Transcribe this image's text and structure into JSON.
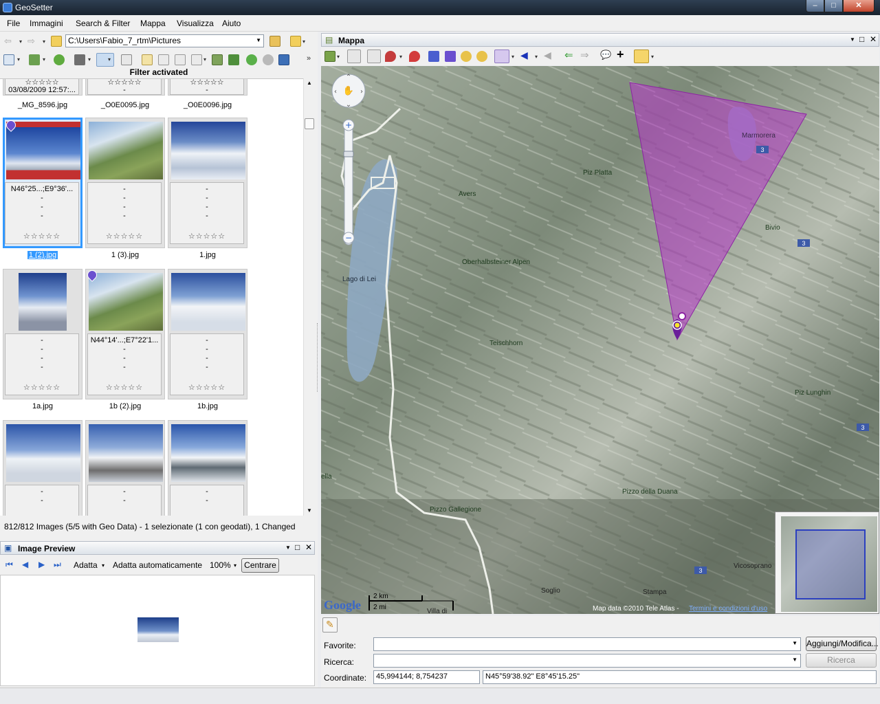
{
  "window": {
    "title": "GeoSetter",
    "min": "–",
    "max": "□",
    "close": "✕"
  },
  "menu": [
    "File",
    "Immagini",
    "Search & Filter",
    "Mappa",
    "Visualizza",
    "Aiuto"
  ],
  "path": "C:\\Users\\Fabio_7_rtm\\Pictures",
  "filter_label": "Filter activated",
  "top_strip": {
    "date": "03/08/2009 12:57:...",
    "names": [
      "_MG_8596.jpg",
      "_O0E0095.jpg",
      "_O0E0096.jpg"
    ]
  },
  "thumbs": [
    {
      "name": "1 (2).jpg",
      "coords": "N46°25...;E9°36'...",
      "selected": true,
      "geo": true
    },
    {
      "name": "1 (3).jpg",
      "coords": "-",
      "selected": false,
      "geo": false
    },
    {
      "name": "1.jpg",
      "coords": "-",
      "selected": false,
      "geo": false
    },
    {
      "name": "1a.jpg",
      "coords": "-",
      "selected": false,
      "geo": false
    },
    {
      "name": "1b (2).jpg",
      "coords": "N44°14'...;E7°22'1...",
      "selected": false,
      "geo": true
    },
    {
      "name": "1b.jpg",
      "coords": "-",
      "selected": false,
      "geo": false
    },
    {
      "name": "",
      "coords": "-",
      "selected": false,
      "geo": false
    },
    {
      "name": "",
      "coords": "-",
      "selected": false,
      "geo": false
    },
    {
      "name": "",
      "coords": "-",
      "selected": false,
      "geo": false
    }
  ],
  "dash": "-",
  "stars": "☆☆☆☆☆",
  "status": "812/812 Images (5/5 with Geo Data) - 1 selezionate (1 con geodati), 1 Changed",
  "preview": {
    "title": "Image Preview",
    "fit": "Adatta",
    "auto_fit": "Adatta automaticamente",
    "zoom": "100%",
    "center": "Centrare"
  },
  "map": {
    "title": "Mappa",
    "labels": [
      "Marmorera",
      "Piz Platta",
      "Avers",
      "Bivio",
      "Oberhalbsteiner Alpen",
      "Lago di Lei",
      "Teischhorn",
      "Piz Lunghin",
      "Pizzo della Duana",
      "Pizzo Gallegione",
      "Vicosoprano",
      "Soglio",
      "Stampa",
      "Villa di",
      "ella"
    ],
    "road_numbers": [
      "3",
      "3",
      "3",
      "3"
    ],
    "scale_km": "2 km",
    "scale_mi": "2 mi",
    "copyright": "Map data ©2010 Tele Atlas -",
    "terms": "Termini e condizioni d'uso",
    "google": "Google"
  },
  "form": {
    "favorite_label": "Favorite:",
    "search_label": "Ricerca:",
    "coord_label": "Coordinate:",
    "add_modify": "Aggiungi/Modifica...",
    "search_btn": "Ricerca",
    "coord_decimal": "45,994144; 8,754237",
    "coord_dms": "N45°59'38.92\" E8°45'15.25\""
  }
}
